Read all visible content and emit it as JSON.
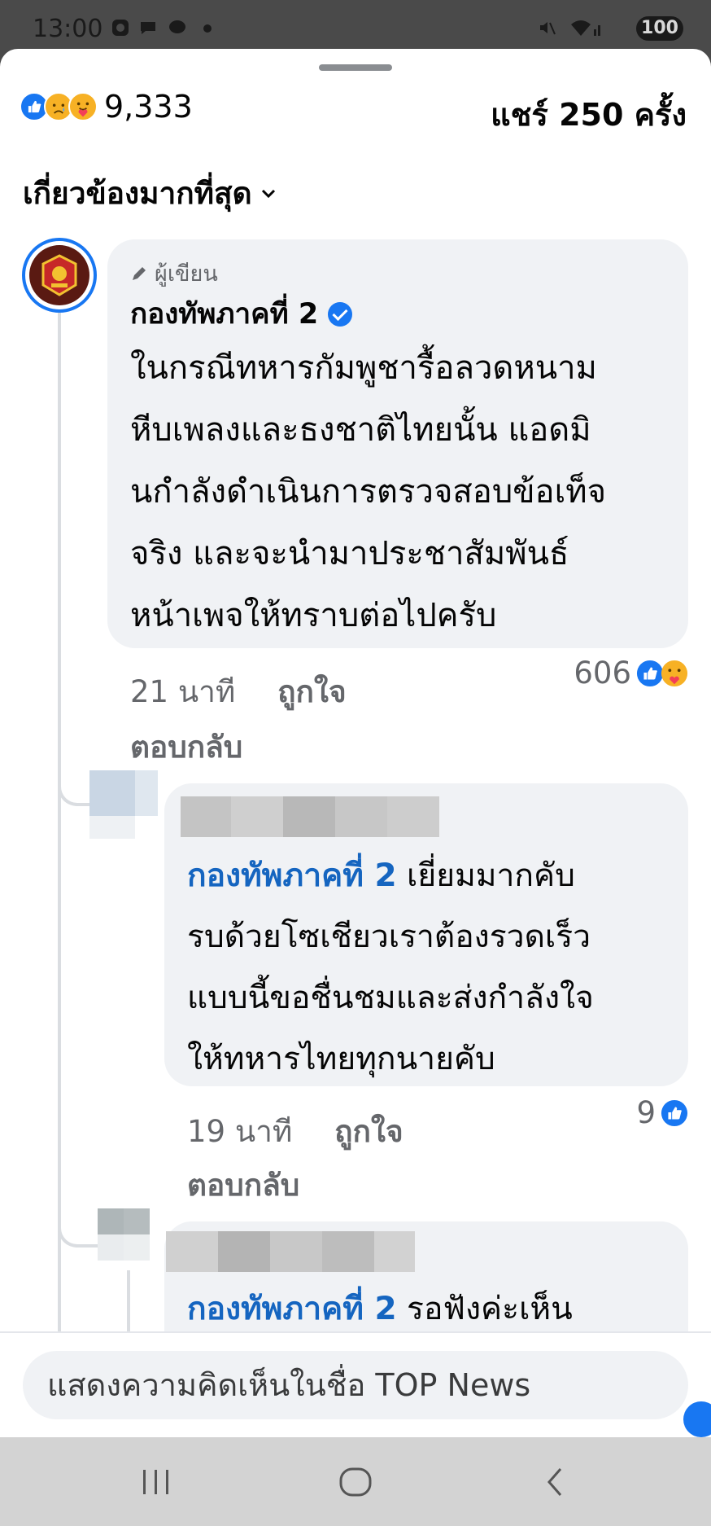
{
  "status_bar": {
    "time": "13:00",
    "battery": "100"
  },
  "post_summary": {
    "reactions_count": "9,333",
    "shares": "แชร์ 250 ครั้ง"
  },
  "sort": {
    "label": "เกี่ยวข้องมากที่สุด"
  },
  "main_comment": {
    "badge": "ผู้เขียน",
    "author": "กองทัพภาคที่ 2",
    "lines": [
      "ในกรณีทหารกัมพูชารื้อลวดหนาม",
      "หีบเพลงและธงชาติไทยนั้น แอดมิ",
      "นกำลังดำเนินการตรวจสอบข้อเท็จ",
      "จริง และจะนำมาประชาสัมพันธ์",
      "หน้าเพจให้ทราบต่อไปครับ"
    ],
    "time": "21 นาที",
    "like": "ถูกใจ",
    "reply": "ตอบกลับ",
    "reaction_count": "606"
  },
  "reply1": {
    "mention": "กองทัพภาคที่ 2",
    "lines": [
      "เยี่ยมมากคับ",
      "รบด้วยโซเชียวเราต้องรวดเร็ว",
      "แบบนี้ขอชื่นชมและส่งกำลังใจ",
      "ให้ทหารไทยทุกนายคับ"
    ],
    "time": "19 นาที",
    "like": "ถูกใจ",
    "reply": "ตอบกลับ",
    "reaction_count": "9"
  },
  "reply2": {
    "mention": "กองทัพภาคที่ 2",
    "text": "รอฟังค่ะเห็น"
  },
  "composer": {
    "placeholder": "แสดงความคิดเห็นในชื่อ TOP News"
  },
  "colors": {
    "accent": "#1877f2",
    "mention": "#1565c0",
    "bubble": "#f0f2f5"
  },
  "icons": [
    "like-icon",
    "sad-icon",
    "care-icon",
    "pencil-icon",
    "verified-icon",
    "chevron-down-icon",
    "recent-apps-icon",
    "home-icon",
    "back-icon"
  ]
}
